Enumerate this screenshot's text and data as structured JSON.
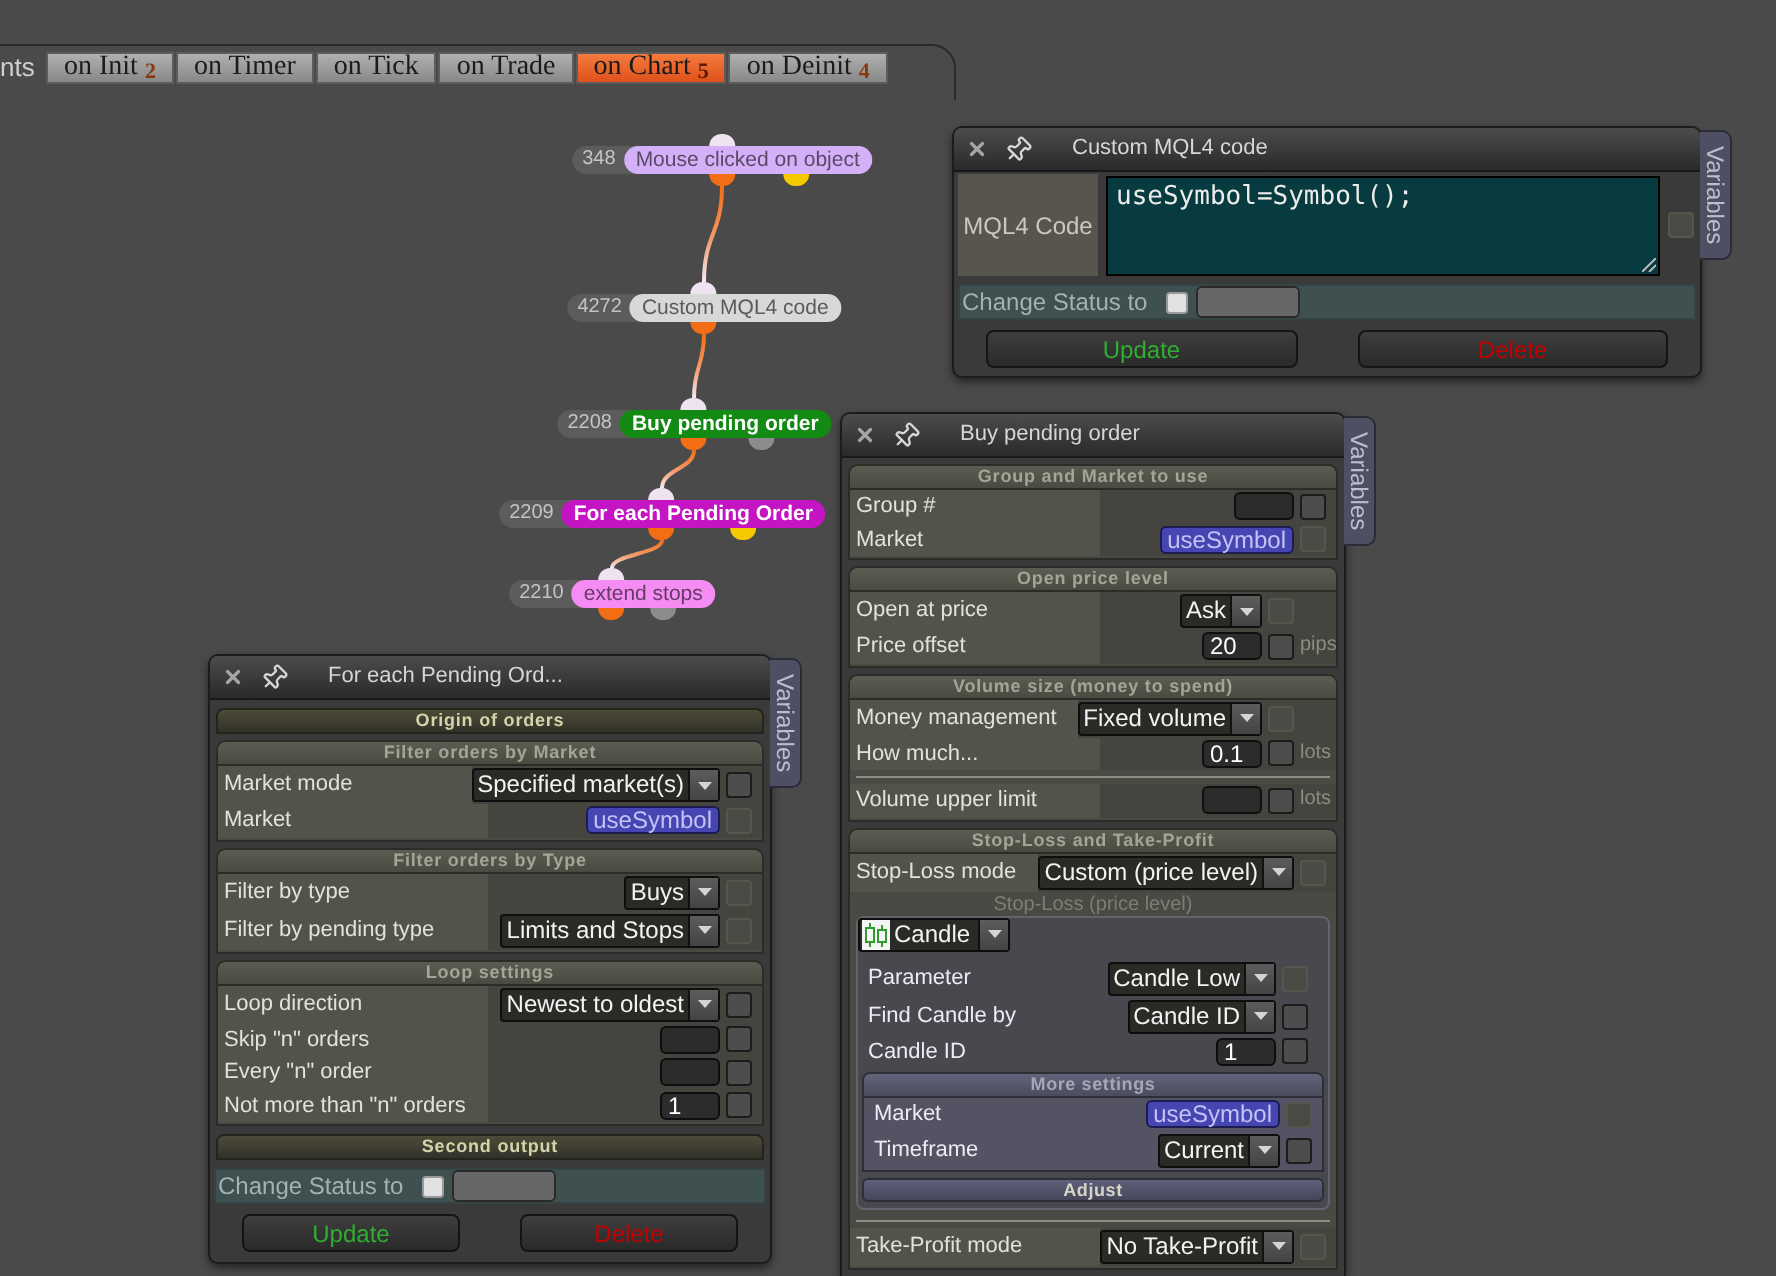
{
  "event_tabs": {
    "caption": "nts",
    "tabs": [
      {
        "label": "on Init",
        "count": "2",
        "selected": false
      },
      {
        "label": "on Timer",
        "selected": false
      },
      {
        "label": "on Tick",
        "selected": false
      },
      {
        "label": "on Trade",
        "selected": false
      },
      {
        "label": "on Chart",
        "count": "5",
        "selected": true
      },
      {
        "label": "on Deinit",
        "count": "4",
        "selected": false
      }
    ]
  },
  "nodes": [
    {
      "number": "348",
      "title": "Mouse clicked on object",
      "color": "#d4b0f8",
      "outputs": [
        {
          "color": "#f36d14"
        },
        {
          "color": "#f5c800"
        }
      ]
    },
    {
      "number": "4272",
      "title": "Custom MQL4 code",
      "color": "#d8d8d8",
      "outputs": [
        {
          "color": "#f36d14"
        }
      ]
    },
    {
      "number": "2208",
      "title": "Buy pending order",
      "color": "#138a13",
      "outputs": [
        {
          "color": "#f36d14"
        },
        {
          "color": "#8c8c8c"
        }
      ]
    },
    {
      "number": "2209",
      "title": "For each Pending Order",
      "color": "#c414c4",
      "outputs": [
        {
          "color": "#f36d14"
        },
        {
          "color": "#f5c800"
        }
      ]
    },
    {
      "number": "2210",
      "title": "extend stops",
      "color": "#f48cf4",
      "outputs": [
        {
          "color": "#f36d14"
        },
        {
          "color": "#8c8c8c"
        }
      ]
    }
  ],
  "windows": [
    {
      "title": "Custom MQL4 code",
      "side_tab": "Variables",
      "blocks": [
        {
          "kind": "code",
          "label": "MQL4 Code",
          "value": "useSymbol=Symbol();",
          "checked": false,
          "disabled": true
        },
        {
          "kind": "status",
          "label": "Change Status to",
          "checked": false
        },
        {
          "kind": "buttons",
          "buttons": [
            {
              "label": "Update",
              "kind": "update"
            },
            {
              "label": "Delete",
              "kind": "delete"
            }
          ]
        }
      ]
    },
    {
      "title": "Buy pending order",
      "side_tab": "Variables",
      "blocks": [
        {
          "kind": "section",
          "title": "Group and Market to use",
          "rows": [
            {
              "kind": "input",
              "label": "Group #",
              "checked": false,
              "disabled": false
            },
            {
              "kind": "variable",
              "label": "Market",
              "value": "useSymbol",
              "checked": false,
              "disabled": true
            }
          ]
        },
        {
          "kind": "section",
          "title": "Open price level",
          "rows": [
            {
              "kind": "dropdown",
              "label": "Open at price",
              "value": "Ask",
              "checked": false,
              "disabled": true
            },
            {
              "kind": "input",
              "label": "Price offset",
              "value": "20",
              "unit": "pips",
              "checked": false,
              "disabled": false
            }
          ]
        },
        {
          "kind": "section",
          "title": "Volume size (money to spend)",
          "rows": [
            {
              "kind": "dropdown",
              "label": "Money management",
              "value": "Fixed volume",
              "checked": false,
              "disabled": true
            },
            {
              "kind": "input",
              "label": "How much...",
              "value": "0.1",
              "unit": "lots",
              "checked": false,
              "disabled": false
            },
            {
              "kind": "input",
              "label": "Volume upper limit",
              "unit": "lots",
              "separated": true,
              "checked": false,
              "disabled": false
            }
          ]
        },
        {
          "kind": "section",
          "title": "Stop-Loss and Take-Profit",
          "rows": [
            {
              "kind": "dropdown",
              "label": "Stop-Loss mode",
              "value": "Custom (price level)",
              "checked": false,
              "disabled": true
            },
            {
              "kind": "subpanel",
              "caption": "Stop-Loss (price level)",
              "selector": "Candle",
              "rows": [
                {
                  "kind": "dropdown",
                  "label": "Parameter",
                  "value": "Candle Low",
                  "checked": false,
                  "disabled": true
                },
                {
                  "kind": "dropdown",
                  "label": "Find Candle by",
                  "value": "Candle ID",
                  "checked": false,
                  "disabled": false
                },
                {
                  "kind": "input",
                  "label": "Candle ID",
                  "value": "1",
                  "checked": false,
                  "disabled": false
                }
              ],
              "more_title": "More settings",
              "more_rows": [
                {
                  "kind": "variable",
                  "label": "Market",
                  "value": "useSymbol",
                  "checked": false,
                  "disabled": true
                },
                {
                  "kind": "dropdown",
                  "label": "Timeframe",
                  "value": "Current",
                  "checked": false,
                  "disabled": false
                }
              ],
              "action": "Adjust"
            },
            {
              "kind": "dropdown",
              "label": "Take-Profit mode",
              "value": "No Take-Profit",
              "separated": true,
              "checked": false,
              "disabled": true
            }
          ]
        }
      ]
    },
    {
      "title": "For each Pending Ord...",
      "side_tab": "Variables",
      "blocks": [
        {
          "kind": "heading",
          "text": "Origin of orders"
        },
        {
          "kind": "section",
          "title": "Filter orders by Market",
          "rows": [
            {
              "kind": "dropdown",
              "label": "Market mode",
              "value": "Specified market(s)",
              "checked": false,
              "disabled": false
            },
            {
              "kind": "variable",
              "label": "Market",
              "value": "useSymbol",
              "checked": false,
              "disabled": true
            }
          ]
        },
        {
          "kind": "section",
          "title": "Filter orders by Type",
          "rows": [
            {
              "kind": "dropdown",
              "label": "Filter by type",
              "value": "Buys",
              "checked": false,
              "disabled": true
            },
            {
              "kind": "dropdown",
              "label": "Filter by pending type",
              "value": "Limits and Stops",
              "checked": false,
              "disabled": true
            }
          ]
        },
        {
          "kind": "section",
          "title": "Loop settings",
          "rows": [
            {
              "kind": "dropdown",
              "label": "Loop direction",
              "value": "Newest to oldest",
              "checked": false,
              "disabled": false
            },
            {
              "kind": "input",
              "label": "Skip \"n\" orders",
              "checked": false,
              "disabled": false
            },
            {
              "kind": "input",
              "label": "Every \"n\" order",
              "checked": false,
              "disabled": false
            },
            {
              "kind": "input",
              "label": "Not more than \"n\" orders",
              "value": "1",
              "checked": false,
              "disabled": false
            }
          ]
        },
        {
          "kind": "heading",
          "text": "Second output"
        },
        {
          "kind": "status",
          "label": "Change Status to",
          "checked": false
        },
        {
          "kind": "buttons",
          "buttons": [
            {
              "label": "Update",
              "kind": "update"
            },
            {
              "label": "Delete",
              "kind": "delete"
            }
          ]
        }
      ]
    }
  ]
}
